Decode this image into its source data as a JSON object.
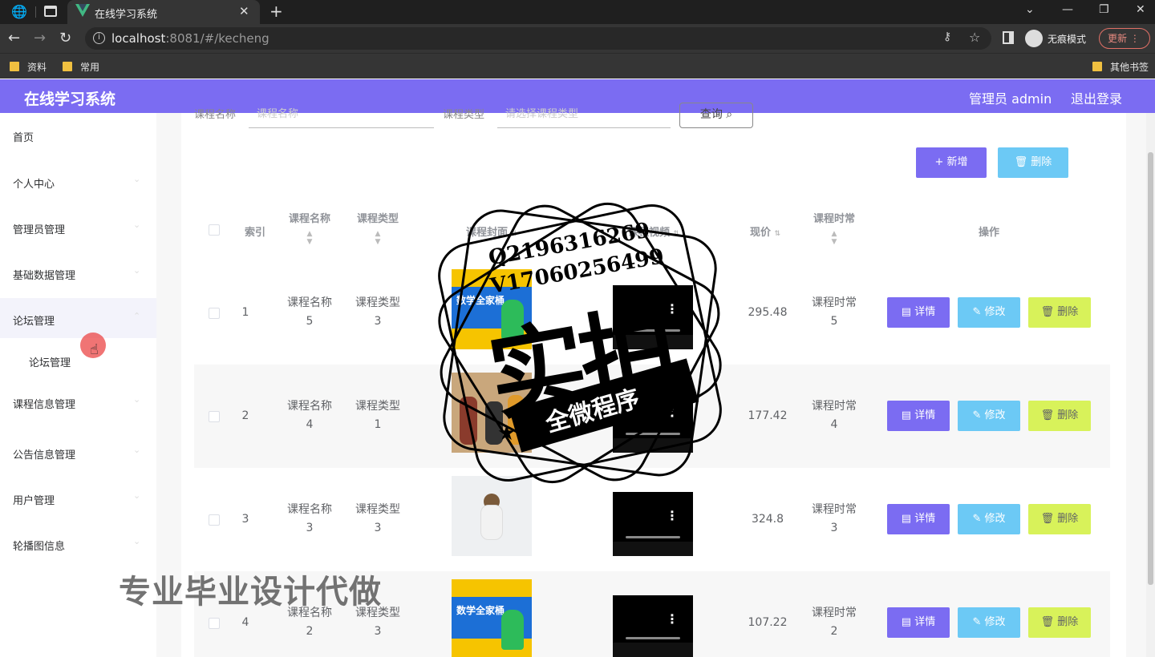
{
  "browser": {
    "tab_title": "在线学习系统",
    "url_host": "localhost",
    "url_rest": ":8081/#/kecheng",
    "incognito_label": "无痕模式",
    "update_label": "更新",
    "bookmarks": [
      "资料",
      "常用"
    ],
    "other_bookmarks": "其他书签"
  },
  "header": {
    "brand": "在线学习系统",
    "admin": "管理员 admin",
    "logout": "退出登录"
  },
  "sidebar": {
    "items": [
      {
        "label": "首页"
      },
      {
        "label": "个人中心"
      },
      {
        "label": "管理员管理"
      },
      {
        "label": "基础数据管理"
      },
      {
        "label": "论坛管理"
      },
      {
        "label": "论坛管理"
      },
      {
        "label": "课程信息管理"
      },
      {
        "label": "公告信息管理"
      },
      {
        "label": "用户管理"
      },
      {
        "label": "轮播图信息"
      }
    ]
  },
  "search": {
    "name_label": "课程名称",
    "name_placeholder": "课程名称",
    "type_label": "课程类型",
    "type_placeholder": "请选择课程类型",
    "query_button": "查询 ⌕"
  },
  "toolbar": {
    "add_label": "+ 新增",
    "delete_label": "🗑 删除"
  },
  "table": {
    "headers": {
      "index": "索引",
      "name": "课程名称",
      "type": "课程类型",
      "cover": "课程封面",
      "video": "课程视频",
      "price": "现价",
      "duration": "课程时常",
      "actions": "操作"
    },
    "rows": [
      {
        "index": "1",
        "name": "课程名称",
        "name_no": "5",
        "type": "课程类型",
        "type_no": "3",
        "price": "295.48",
        "duration": "课程时常",
        "duration_no": "5"
      },
      {
        "index": "2",
        "name": "课程名称",
        "name_no": "4",
        "type": "课程类型",
        "type_no": "1",
        "price": "177.42",
        "duration": "课程时常",
        "duration_no": "4"
      },
      {
        "index": "3",
        "name": "课程名称",
        "name_no": "3",
        "type": "课程类型",
        "type_no": "3",
        "price": "324.8",
        "duration": "课程时常",
        "duration_no": "3"
      },
      {
        "index": "4",
        "name": "课程名称",
        "name_no": "2",
        "type": "课程类型",
        "type_no": "3",
        "price": "107.22",
        "duration": "课程时常",
        "duration_no": "2"
      }
    ],
    "actions": {
      "detail": "▤ 详情",
      "edit": "✎ 修改",
      "delete": "🗑 删除"
    },
    "cover_text": "数学全家桶"
  },
  "overlay": {
    "watermark": "专业毕业设计代做",
    "stamp_qq": "Q2196316269",
    "stamp_vx": "V17060256499",
    "stamp_big": "实拍",
    "stamp_ribbon": "全微程序"
  },
  "colors": {
    "header": "#7b6cf2",
    "add_button": "#7b6cf2",
    "delete_button": "#6cc9f5",
    "row_delete_button": "#d8f25a"
  }
}
